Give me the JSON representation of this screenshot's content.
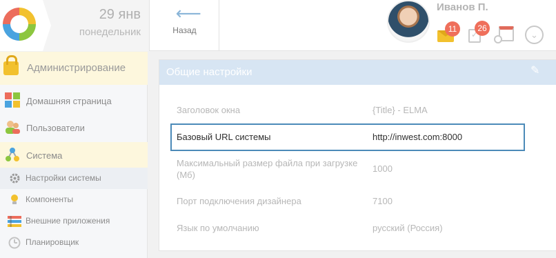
{
  "header": {
    "date_day": "29 янв",
    "date_weekday": "понедельник",
    "back_label": "Назад",
    "user_name": "Иванов П.",
    "mail_count": "11",
    "task_count": "26",
    "icons": [
      "logo",
      "back-arrow-icon",
      "mail-icon",
      "tasks-icon",
      "calendar-icon",
      "dropdown-chevron-icon"
    ]
  },
  "sidebar": {
    "section_title": "Администрирование",
    "items": [
      {
        "label": "Домашняя страница",
        "icon": "home-grid-icon"
      },
      {
        "label": "Пользователи",
        "icon": "users-icon"
      },
      {
        "label": "Система",
        "icon": "system-icon"
      }
    ],
    "sub_items": [
      {
        "label": "Настройки системы",
        "icon": "gear-icon",
        "active": true
      },
      {
        "label": "Компоненты",
        "icon": "bulb-icon"
      },
      {
        "label": "Внешние приложения",
        "icon": "apps-icon"
      },
      {
        "label": "Планировщик",
        "icon": "clock-icon"
      }
    ]
  },
  "panel": {
    "title": "Общие настройки",
    "rows": [
      {
        "key": "Заголовок окна",
        "value": "{Title} - ELMA"
      },
      {
        "key": "Базовый URL системы",
        "value": "http://inwest.com:8000",
        "highlighted": true
      },
      {
        "key": "Максимальный размер файла при загрузке (Мб)",
        "value": "1000"
      },
      {
        "key": "Порт подключения дизайнера",
        "value": "7100"
      },
      {
        "key": "Язык по умолчанию",
        "value": "русский (Россия)"
      }
    ]
  },
  "colors": {
    "accent_blue": "#4b8ab8",
    "panel_header": "#d7e5f3",
    "badge_red": "#ef6f5b",
    "sidebar_head_bg": "#fdf7dd"
  }
}
